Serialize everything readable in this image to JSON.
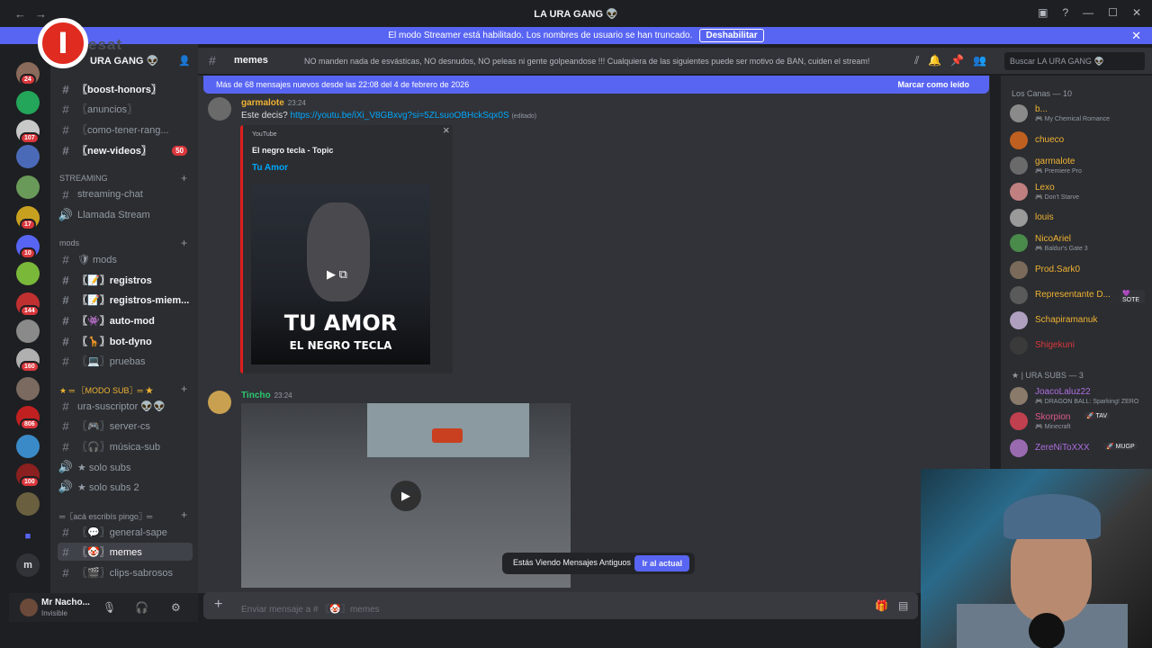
{
  "window": {
    "title": "LA URA GANG 👽"
  },
  "banner": {
    "text": "El modo Streamer está habilitado. Los nombres de usuario se han truncado.",
    "button": "Deshabilitar"
  },
  "overlay": {
    "logo_letter": "I",
    "logo_text": "esat"
  },
  "guild_badges": [
    "24",
    "107",
    "17",
    "10",
    "144",
    "160",
    "806",
    "100"
  ],
  "server": {
    "name": "URA GANG 👽"
  },
  "channels": [
    {
      "name": "〖boost-honors〗",
      "unread": true
    },
    {
      "name": "〖anuncios〗",
      "unread": false
    },
    {
      "name": "〖como-tener-rang...",
      "unread": false
    },
    {
      "name": "〖new-videos〗",
      "unread": true,
      "badge": "50"
    }
  ],
  "categories": {
    "streaming": "STREAMING",
    "mods": "mods",
    "modo_sub": "★ ═ 〖MODO SUB〗═ ★",
    "aca": "═〖acá escribís pingo〗═"
  },
  "streaming_channels": [
    "streaming-chat",
    "Llamada Stream"
  ],
  "mods_channels": [
    {
      "name": "🛡 mods",
      "unread": false
    },
    {
      "name": "〖📝〗registros",
      "unread": true
    },
    {
      "name": "〖📝〗registros-miem...",
      "unread": true
    },
    {
      "name": "〖👾〗auto-mod",
      "unread": true
    },
    {
      "name": "〖🦒〗bot-dyno",
      "unread": true
    },
    {
      "name": "〖💻〗pruebas",
      "unread": false
    }
  ],
  "sub_channels": [
    "ura-suscriptor 👽👽",
    "〖🎮〗server-cs",
    "〖🎧〗música-sub",
    "★ solo subs",
    "★ solo subs 2"
  ],
  "aca_channels": [
    "〖💬〗general-sape",
    "〖🤡〗memes",
    "〖🎬〗clips-sabrosos"
  ],
  "user": {
    "name": "Mr Nacho...",
    "status": "Invisible"
  },
  "header": {
    "channel": "memes",
    "topic": "NO manden nada de esvásticas, NO desnudos, NO peleas ni gente golpeandose !!! Cualquiera de las siguientes puede ser motivo de BAN, cuiden el stream!",
    "search": "Buscar LA URA GANG 👽"
  },
  "newbar": {
    "text": "Más de 68 mensajes nuevos desde las 22:08 del 4 de febrero de 2026",
    "mark": "Marcar como leído"
  },
  "messages": [
    {
      "author": "garmalote",
      "time": "23:24",
      "text": "Este decis? ",
      "link": "https://youtu.be/iXi_V8GBxvg?si=5ZLsuoOBHckSqx0S",
      "edited": "(editado)"
    },
    {
      "author": "Tincho",
      "time": "23:24"
    }
  ],
  "embed": {
    "provider": "YouTube",
    "author": "El negro tecla - Topic",
    "title": "Tu Amor",
    "thumb_title": "TU AMOR",
    "thumb_sub": "EL NEGRO TECLA",
    "close": "×"
  },
  "old_messages": {
    "text": "Estás Viendo Mensajes Antiguos",
    "button": "Ir al actual"
  },
  "input": {
    "placeholder": "Enviar mensaje a # 〖🤡〗memes"
  },
  "members": {
    "group1": "Los Canas — 10",
    "group2": "★ | URA SUBS — 3",
    "list1": [
      {
        "name": "b...",
        "status": "🎮 My Chemical Romance",
        "color": "#f0b232"
      },
      {
        "name": "chueco",
        "status": "",
        "color": "#f0b232"
      },
      {
        "name": "garmalote",
        "status": "🎮 Premiere Pro",
        "color": "#f0b232"
      },
      {
        "name": "Lexo",
        "status": "🎮 Don't Starve",
        "color": "#f0b232"
      },
      {
        "name": "louis",
        "status": "",
        "color": "#f0b232"
      },
      {
        "name": "NicoAriel",
        "status": "🎮 Baldur's Gate 3",
        "color": "#f0b232"
      },
      {
        "name": "Prod.Sark0",
        "status": "",
        "color": "#f0b232"
      },
      {
        "name": "Representante D...",
        "status": "",
        "color": "#f0b232",
        "tag": "💜 SOTE"
      },
      {
        "name": "Schapiramanuk",
        "status": "",
        "color": "#f0b232"
      },
      {
        "name": "Shigekuni",
        "status": "",
        "color": "#da373c"
      }
    ],
    "list2": [
      {
        "name": "JoacoLaluz22",
        "status": "🎮 DRAGON BALL: Sparking! ZERO",
        "color": "#b06ee0"
      },
      {
        "name": "Skorpion",
        "status": "🎮 Minecraft",
        "color": "#e05a8a",
        "tag": "🚀 TAV"
      },
      {
        "name": "ZereNiToXXX",
        "status": "",
        "color": "#b06ee0",
        "tag": "🚀 MUGP"
      }
    ]
  }
}
